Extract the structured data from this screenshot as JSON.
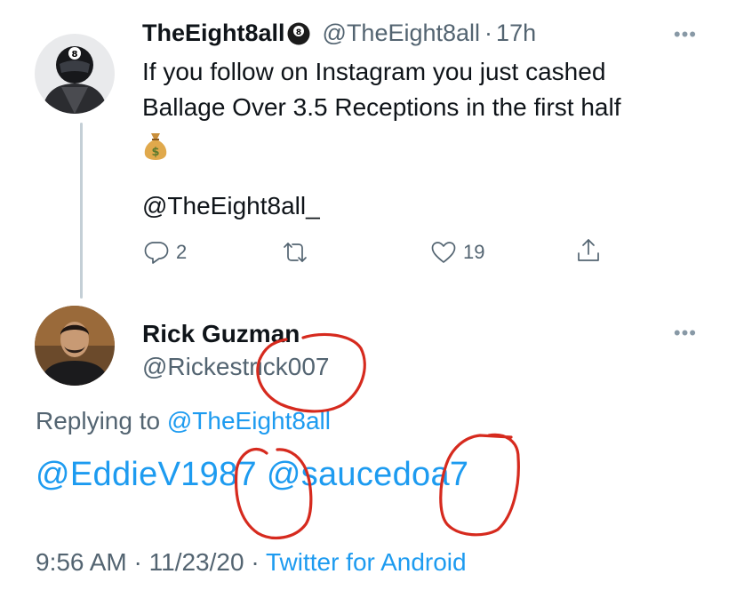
{
  "tweet1": {
    "display_name": "TheEight8all",
    "badge_icon": "8-ball-emoji-icon",
    "handle": "@TheEight8all",
    "separator": "·",
    "time_ago": "17h",
    "more_icon": "more-dots-icon",
    "text_line1": "If you follow on Instagram you just cashed",
    "text_line2": "Ballage Over 3.5 Receptions in the first half",
    "emoji": "money-bag-emoji-icon",
    "mention": "@TheEight8all_",
    "actions": {
      "reply_count": "2",
      "retweet_count": "",
      "like_count": "19"
    }
  },
  "tweet2": {
    "display_name": "Rick Guzman",
    "handle": "@Rickestrick007",
    "more_icon": "more-dots-icon",
    "replying_prefix": "Replying to",
    "replying_handle": "@TheEight8all",
    "body_mention1": "@EddieV1987",
    "body_mention2": "@saucedoa7",
    "time": "9:56 AM",
    "sep1": "·",
    "date": "11/23/20",
    "sep2": "·",
    "source": "Twitter for Android"
  },
  "colors": {
    "link": "#1d9bf0",
    "muted": "#536471",
    "annotation": "#d62a1e",
    "thread_line": "#c4cfd6"
  }
}
